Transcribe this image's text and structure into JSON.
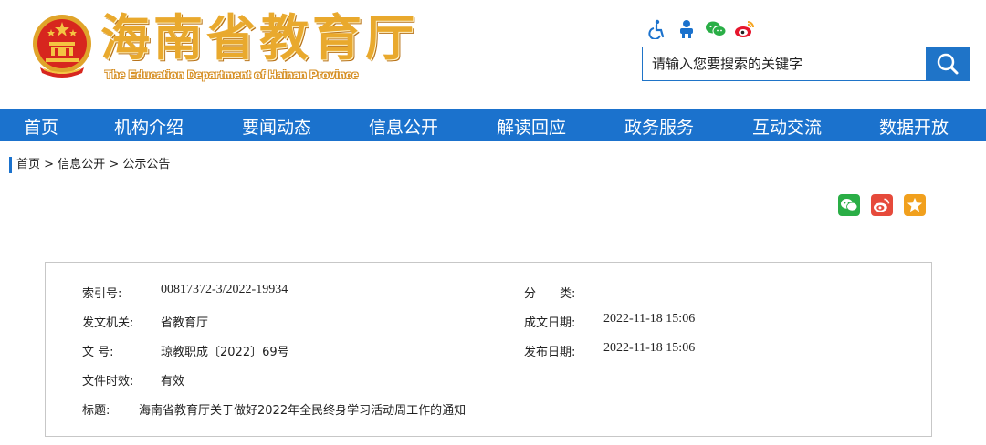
{
  "header": {
    "title": "海南省教育厅",
    "subtitle": "The Education Department of Hainan Province",
    "search_placeholder": "请输入您要搜索的关键字",
    "access_icons": [
      "accessibility-icon",
      "elder-mode-icon",
      "wechat-icon",
      "weibo-icon"
    ]
  },
  "nav": {
    "items": [
      {
        "label": "首页"
      },
      {
        "label": "机构介绍"
      },
      {
        "label": "要闻动态"
      },
      {
        "label": "信息公开"
      },
      {
        "label": "解读回应"
      },
      {
        "label": "政务服务"
      },
      {
        "label": "互动交流"
      },
      {
        "label": "数据开放"
      }
    ]
  },
  "breadcrumb": {
    "items": [
      "首页",
      "信息公开",
      "公示公告"
    ],
    "separator": " > "
  },
  "share": {
    "icons": [
      "wechat-share-icon",
      "weibo-share-icon",
      "favorite-icon"
    ]
  },
  "info": {
    "index_label": "索引号:",
    "index_value": "00817372-3/2022-19934",
    "category_label": "分　　类:",
    "category_value": "",
    "issuer_label": "发文机关:",
    "issuer_value": "省教育厅",
    "created_label": "成文日期:",
    "created_value": "2022-11-18 15:06",
    "docno_label": "文  号:",
    "docno_value": "琼教职成〔2022〕69号",
    "published_label": "发布日期:",
    "published_value": "2022-11-18 15:06",
    "validity_label": "文件时效:",
    "validity_value": "有效",
    "title_label": "标题:",
    "title_value": "海南省教育厅关于做好2022年全民终身学习活动周工作的通知"
  },
  "colors": {
    "brand_blue": "#1b72cd",
    "title_gold": "#e9a92d",
    "emblem_red": "#d7261e"
  }
}
